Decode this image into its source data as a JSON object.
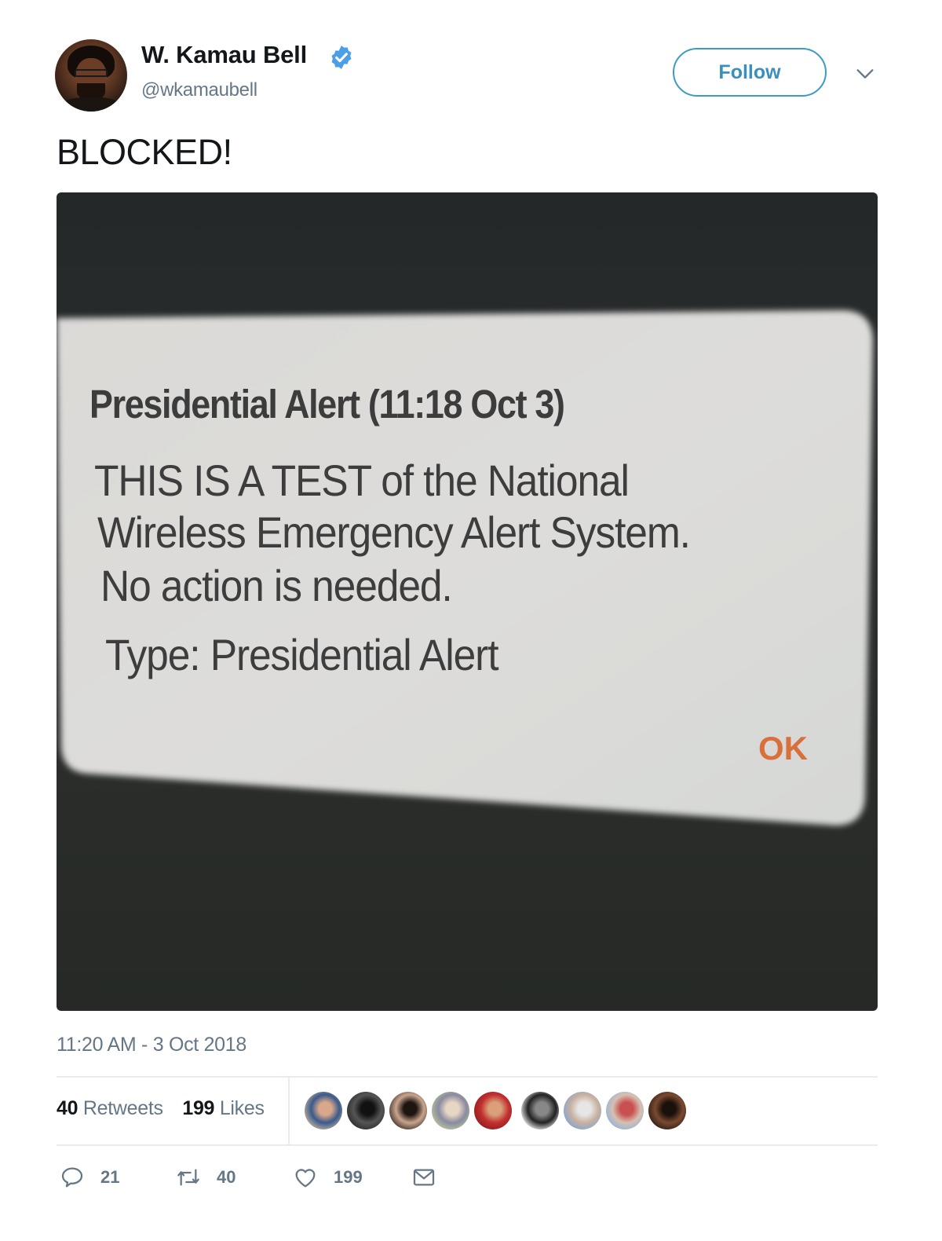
{
  "author": {
    "display_name": "W. Kamau Bell",
    "handle": "@wkamaubell",
    "verified": true,
    "avatar_icon": "profile-photo"
  },
  "header": {
    "follow_label": "Follow",
    "more_icon": "chevron-down-icon"
  },
  "tweet": {
    "text": "BLOCKED!",
    "timestamp": "11:20 AM - 3 Oct 2018"
  },
  "photo": {
    "alert_title": "Presidential Alert (11:18 Oct 3)",
    "alert_body_lines": [
      "THIS IS A TEST of the National",
      "Wireless Emergency Alert System.",
      "No action is needed."
    ],
    "alert_type": "Type: Presidential Alert",
    "ok_label": "OK",
    "colors": {
      "background": "#272b2b",
      "dialog": "#dcdcda",
      "ok": "#d9703c"
    }
  },
  "stats": {
    "retweets_count": "40",
    "retweets_label": "Retweets",
    "likes_count": "199",
    "likes_label": "Likes"
  },
  "likers": [
    {
      "colors": [
        "#c9b79c",
        "#3a5a8c",
        "#d9a88a"
      ]
    },
    {
      "colors": [
        "#2a2a2a",
        "#555555",
        "#111111"
      ]
    },
    {
      "colors": [
        "#3a2a24",
        "#c9a58e",
        "#1e1410"
      ]
    },
    {
      "colors": [
        "#b9c89a",
        "#8a8aa0",
        "#e6d6c4"
      ]
    },
    {
      "colors": [
        "#8c1c1c",
        "#c23030",
        "#d9a07a"
      ]
    },
    {
      "colors": [
        "#ffffff",
        "#222222",
        "#888888"
      ]
    },
    {
      "colors": [
        "#7aa6d6",
        "#c9b0a0",
        "#e6e6e6"
      ]
    },
    {
      "colors": [
        "#8cb4dc",
        "#d6c0b0",
        "#c85050"
      ]
    },
    {
      "colors": [
        "#2a1a14",
        "#7a4a30",
        "#1a100c"
      ]
    }
  ],
  "actions": {
    "reply_count": "21",
    "retweet_count": "40",
    "like_count": "199"
  },
  "colors": {
    "accent": "#1da1f2",
    "secondary_text": "#657786",
    "primary_text": "#14171a",
    "divider": "#e6ecf0"
  }
}
